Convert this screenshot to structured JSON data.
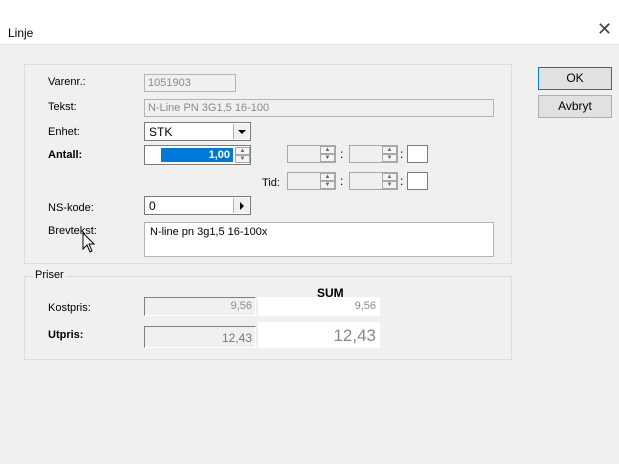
{
  "window": {
    "title": "Linje",
    "close_glyph": "✕"
  },
  "buttons": {
    "ok": "OK",
    "cancel": "Avbryt"
  },
  "form": {
    "varenr_label": "Varenr.:",
    "varenr_value": "1051903",
    "tekst_label": "Tekst:",
    "tekst_value": "N-Line PN 3G1,5  16-100",
    "enhet_label": "Enhet:",
    "enhet_value": "STK",
    "antall_label": "Antall:",
    "antall_value": "1,00",
    "tid_label": "Tid:",
    "time_separator": ":",
    "ns_label": "NS-kode:",
    "ns_value": "0",
    "brevtekst_label": "Brevtekst:",
    "brevtekst_value": "N-line pn 3g1,5 16-100x"
  },
  "prices": {
    "group_label": "Priser",
    "sum_header": "SUM",
    "kost_label": "Kostpris:",
    "kost_value": "9,56",
    "kost_sum": "9,56",
    "ut_label": "Utpris:",
    "ut_value": "12,43",
    "ut_sum": "12,43"
  },
  "colors": {
    "selection": "#0078d7",
    "default_button_border": "#0078d7"
  }
}
